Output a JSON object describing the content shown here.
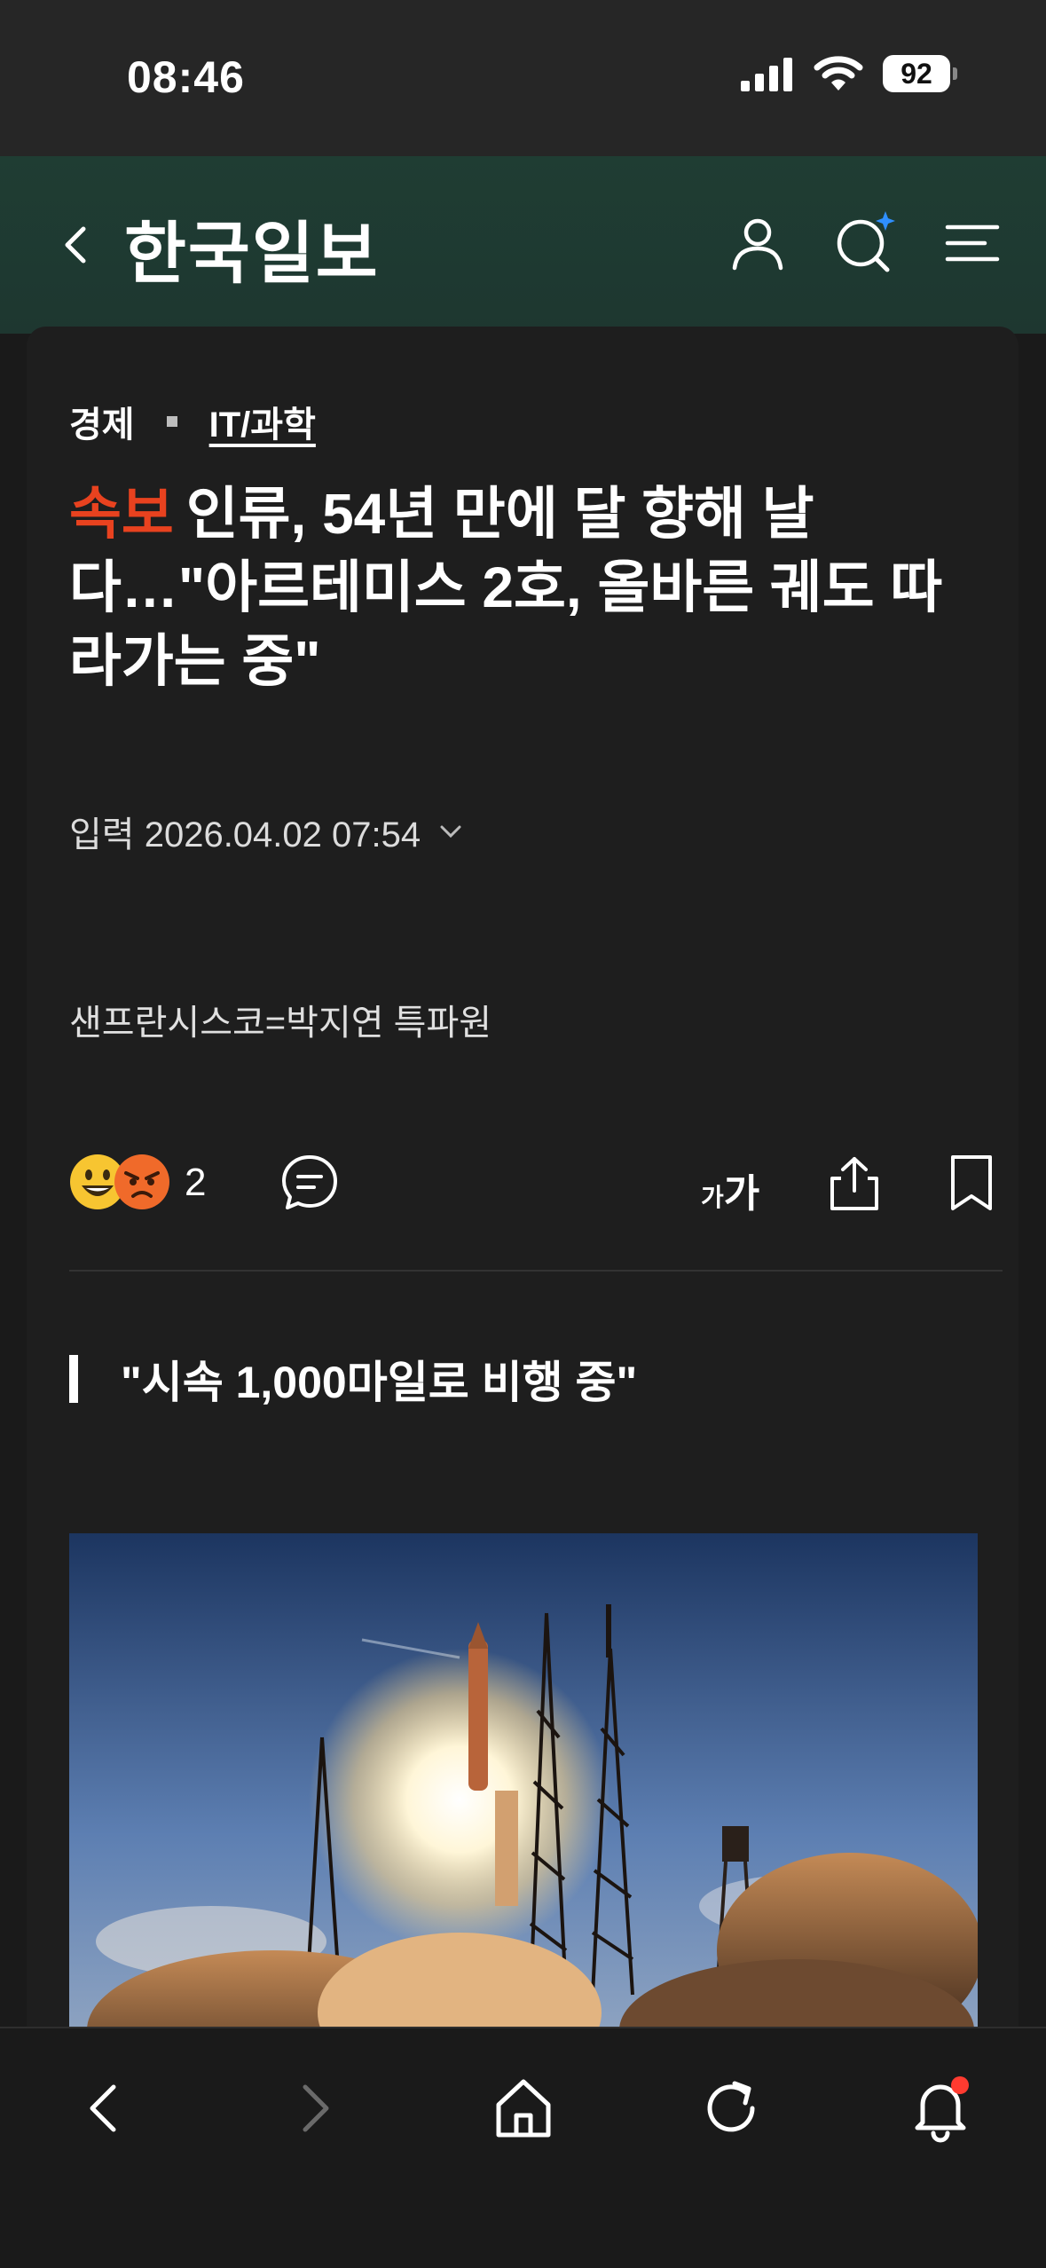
{
  "status_bar": {
    "time": "08:46",
    "battery": "92"
  },
  "header": {
    "logo": "한국일보"
  },
  "article": {
    "categories": [
      "경제",
      "IT/과학"
    ],
    "breaking_label": "속보",
    "title": "인류, 54년 만에 달 향해 날다…\"아르테미스 2호, 올바른 궤도 따라가는 중\"",
    "published": "입력 2026.04.02 07:54",
    "byline": "샌프란시스코=박지연 특파원",
    "reaction_count": "2",
    "font_size_small": "가",
    "font_size_large": "가",
    "subheading": "\"시속 1,000마일로 비행 중\""
  },
  "colors": {
    "accent_breaking": "#e8421f",
    "header_bg": "#1f3d33",
    "notification_dot": "#ff3b30",
    "search_sparkle": "#2f8fff"
  },
  "icons": [
    "back-icon",
    "user-icon",
    "search-icon",
    "menu-icon",
    "comment-icon",
    "font-size-icon",
    "share-icon",
    "bookmark-icon",
    "expand-icon",
    "home-icon",
    "refresh-icon",
    "bell-icon",
    "forward-icon"
  ]
}
